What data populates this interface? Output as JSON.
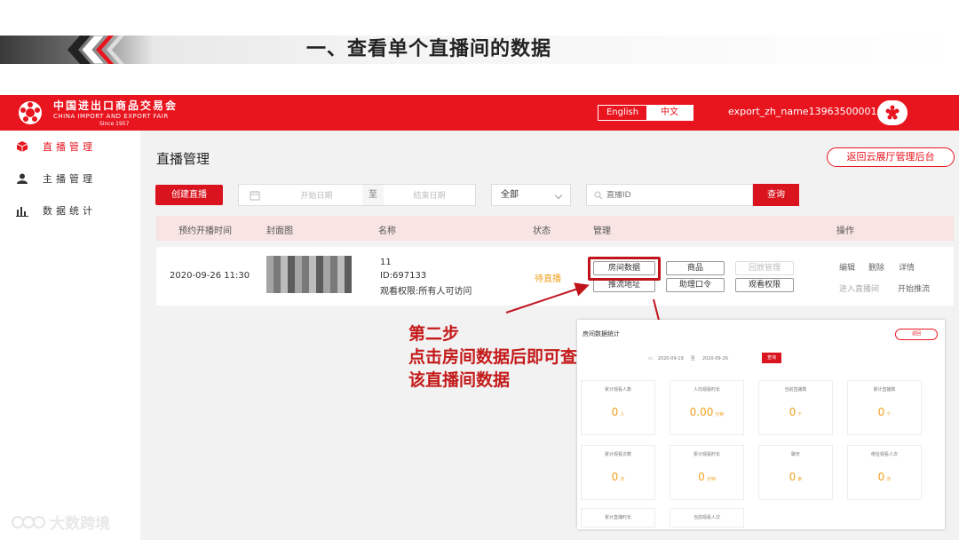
{
  "slide": {
    "title": "一、查看单个直播间的数据"
  },
  "app": {
    "logo": {
      "cn": "中国进出口商品交易会",
      "en": "CHINA IMPORT AND EXPORT FAIR",
      "since": "Since 1957"
    },
    "lang": {
      "english": "English",
      "chinese": "中文"
    },
    "username": "export_zh_name13963500001"
  },
  "sidebar": {
    "items": [
      {
        "label": "直播管理"
      },
      {
        "label": "主播管理"
      },
      {
        "label": "数据统计"
      }
    ]
  },
  "main": {
    "title": "直播管理",
    "back_label": "返回云展厅管理后台",
    "create_label": "创建直播",
    "start_placeholder": "开始日期",
    "date_sep": "至",
    "end_placeholder": "结束日期",
    "status_select": "全部",
    "search_placeholder": "直播ID",
    "query_label": "查询",
    "columns": [
      "预约开播时间",
      "封面图",
      "名称",
      "状态",
      "管理",
      "操作"
    ],
    "row": {
      "time": "2020-09-26 11:30",
      "name": "11",
      "id": "ID:697133",
      "permission": "观看权限:所有人可访问",
      "status": "待直播",
      "manage": [
        "房间数据",
        "商品",
        "回放管理",
        "推流地址",
        "助理口令",
        "观看权限"
      ],
      "ops": [
        "编辑",
        "删除",
        "详情",
        "进入直播间",
        "开始推流"
      ]
    }
  },
  "callout": {
    "line1": "第二步",
    "line2": "点击房间数据后即可查看",
    "line3": "该直播间数据"
  },
  "inset": {
    "title": "房间数据统计",
    "back": "返回",
    "date_start": "2020-09-19",
    "date_sep": "至",
    "date_end": "2020-09-26",
    "query": "查询",
    "cards": [
      {
        "label": "累计观看人数",
        "value": "0",
        "unit": "人"
      },
      {
        "label": "人均观看时长",
        "value": "0.00",
        "unit": "分钟"
      },
      {
        "label": "当前直播数",
        "value": "0",
        "unit": "个"
      },
      {
        "label": "累计直播数",
        "value": "0",
        "unit": "个"
      },
      {
        "label": "累计观看次数",
        "value": "0",
        "unit": "次"
      },
      {
        "label": "累计观看时长",
        "value": "0",
        "unit": "分钟"
      },
      {
        "label": "聊天",
        "value": "0",
        "unit": "条"
      },
      {
        "label": "络址观看人次",
        "value": "0",
        "unit": "次"
      },
      {
        "label": "累计直播时长",
        "value": "",
        "unit": ""
      },
      {
        "label": "当前观看人次",
        "value": "",
        "unit": ""
      }
    ]
  },
  "watermark": "大数跨境",
  "colors": {
    "brand_red": "#e8141e",
    "accent_orange": "#f0a020"
  }
}
